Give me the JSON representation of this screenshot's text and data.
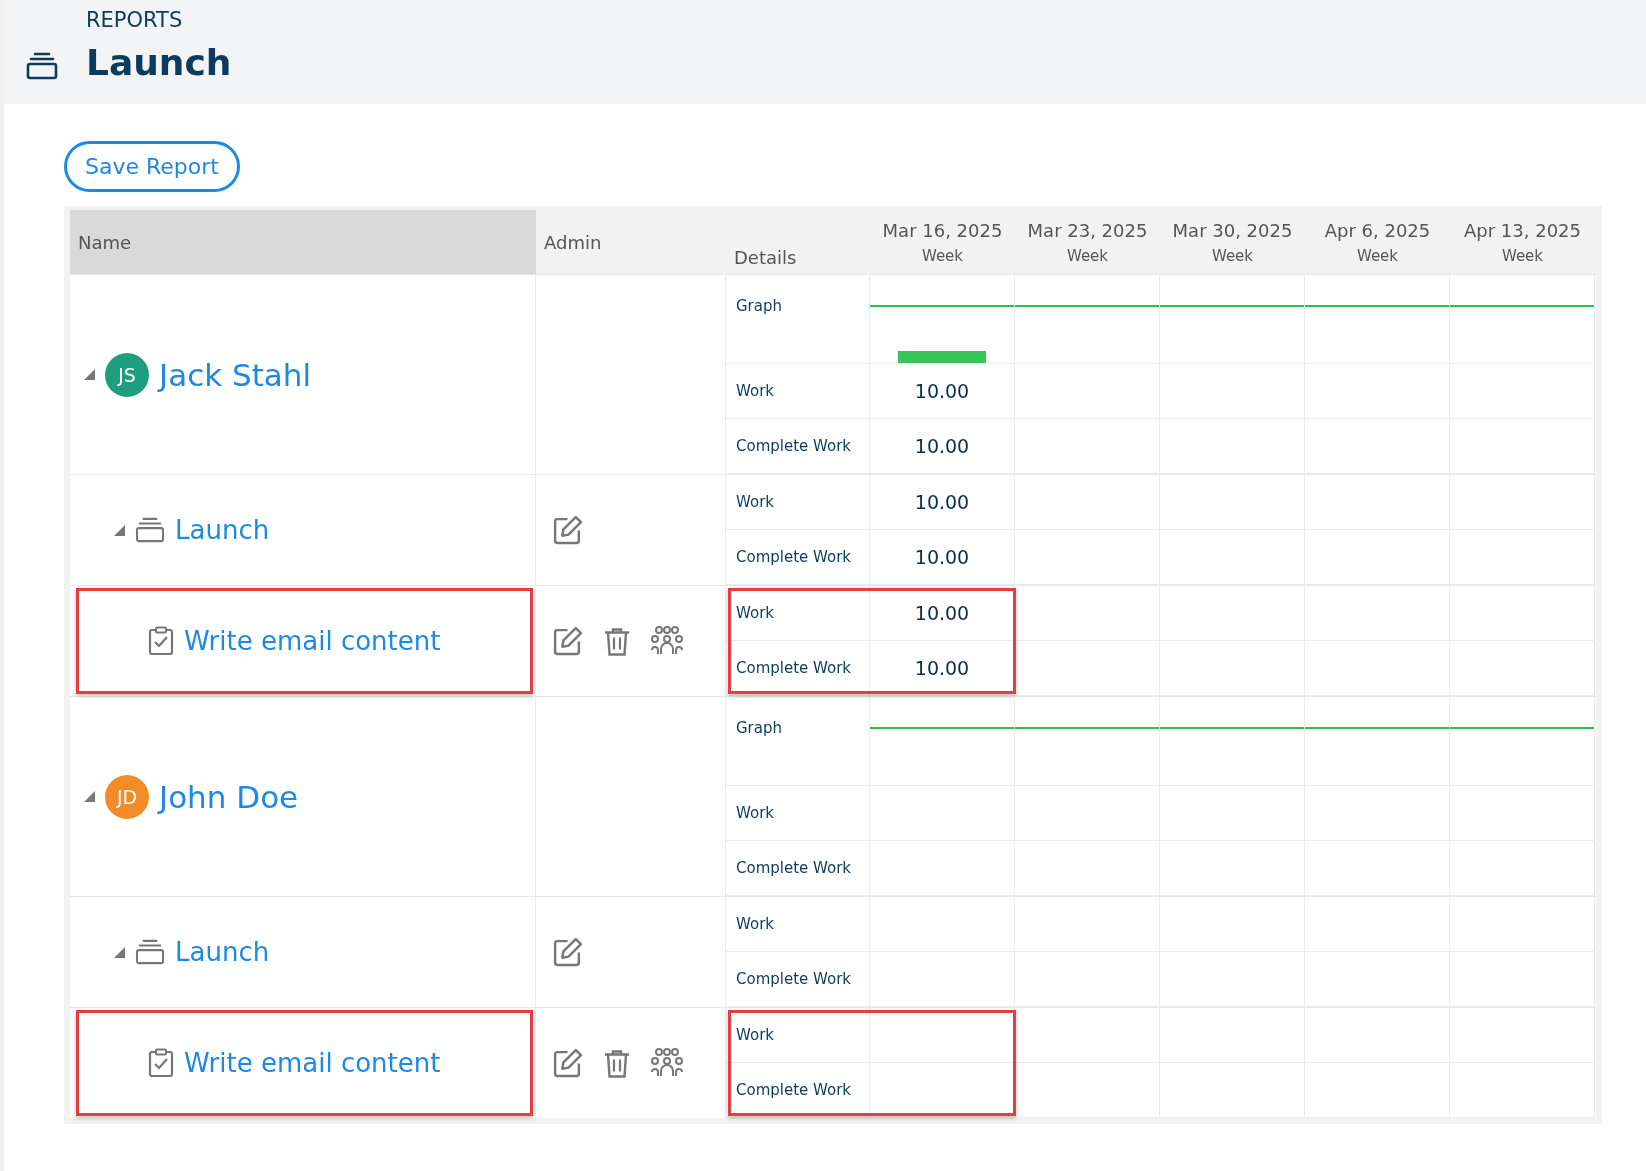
{
  "header": {
    "section": "REPORTS",
    "title": "Launch"
  },
  "save_button": "Save Report",
  "table": {
    "columns": {
      "name": "Name",
      "admin": "Admin",
      "details": "Details"
    },
    "weeks": [
      {
        "date": "Mar 16, 2025",
        "unit": "Week"
      },
      {
        "date": "Mar 23, 2025",
        "unit": "Week"
      },
      {
        "date": "Mar 30, 2025",
        "unit": "Week"
      },
      {
        "date": "Apr 6, 2025",
        "unit": "Week"
      },
      {
        "date": "Apr 13, 2025",
        "unit": "Week"
      }
    ],
    "people": [
      {
        "kind": "person",
        "initials": "JS",
        "name": "Jack Stahl",
        "color": "#1e9e7e",
        "expanded": true,
        "graph": {
          "label": "Graph",
          "weeks": [
            {
              "bar": true
            },
            {
              "bar": false
            },
            {
              "bar": false
            },
            {
              "bar": false
            },
            {
              "bar": false
            }
          ]
        },
        "metrics": [
          {
            "label": "Work",
            "cells": [
              "10.00"
            ]
          },
          {
            "label": "Complete Work",
            "cells": [
              "10.00"
            ]
          }
        ],
        "children": [
          {
            "kind": "project",
            "name": "Launch",
            "expanded": true,
            "metrics": [
              {
                "label": "Work",
                "cells": [
                  "10.00"
                ]
              },
              {
                "label": "Complete Work",
                "cells": [
                  "10.00"
                ]
              }
            ],
            "children": [
              {
                "kind": "task",
                "name": "Write email content",
                "highlighted": true,
                "metrics": [
                  {
                    "label": "Work",
                    "cells": [
                      "10.00"
                    ]
                  },
                  {
                    "label": "Complete Work",
                    "cells": [
                      "10.00"
                    ]
                  }
                ]
              }
            ]
          }
        ]
      },
      {
        "kind": "person",
        "initials": "JD",
        "name": "John Doe",
        "color": "#f28c28",
        "expanded": true,
        "graph": {
          "label": "Graph",
          "weeks": [
            {
              "bar": false
            },
            {
              "bar": false
            },
            {
              "bar": false
            },
            {
              "bar": false
            },
            {
              "bar": false
            }
          ]
        },
        "metrics": [
          {
            "label": "Work"
          },
          {
            "label": "Complete Work"
          }
        ],
        "children": [
          {
            "kind": "project",
            "name": "Launch",
            "expanded": true,
            "metrics": [
              {
                "label": "Work"
              },
              {
                "label": "Complete Work"
              }
            ],
            "children": [
              {
                "kind": "task",
                "name": "Write email content",
                "highlighted": true,
                "metrics": [
                  {
                    "label": "Work"
                  },
                  {
                    "label": "Complete Work"
                  }
                ]
              }
            ]
          }
        ]
      }
    ]
  }
}
